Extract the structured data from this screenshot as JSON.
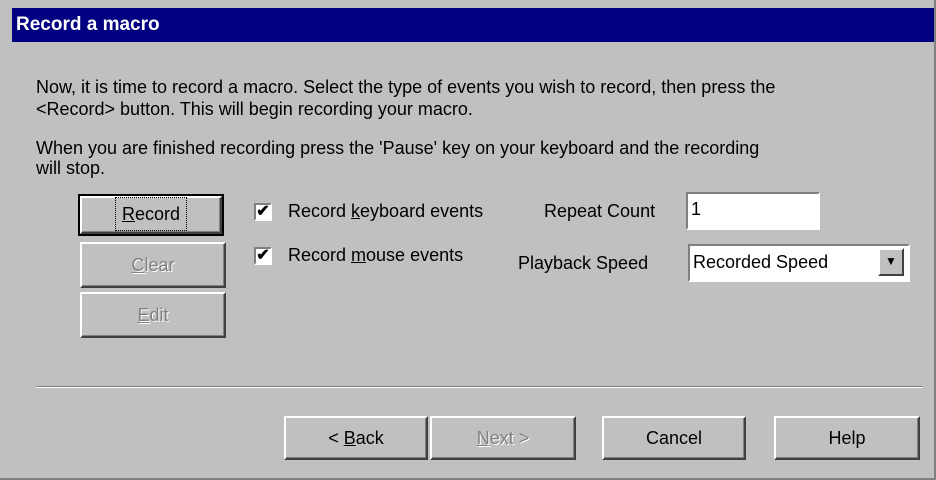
{
  "dialog": {
    "title": "Record a macro",
    "intro_line1": "Now, it is time to record a macro.  Select the type of events you wish to record, then press the",
    "intro_line2": "<Record> button.  This will begin recording your macro.",
    "finish_line1": "When you are finished recording press the 'Pause' key on your keyboard and the recording",
    "finish_line2": "will stop."
  },
  "buttons": {
    "record": {
      "pre": "",
      "u": "R",
      "post": "ecord"
    },
    "clear": {
      "pre": "",
      "u": "C",
      "post": "lear"
    },
    "edit": {
      "pre": "",
      "u": "E",
      "post": "dit"
    }
  },
  "options": {
    "keyboard": {
      "checked": true,
      "pre": "Record ",
      "u": "k",
      "post": "eyboard events"
    },
    "mouse": {
      "checked": true,
      "pre": "Record ",
      "u": "m",
      "post": "ouse events"
    },
    "check_glyph": "✔",
    "repeat_label": "Repeat Count",
    "repeat_value": "1",
    "speed_label": "Playback Speed",
    "speed_value": "Recorded Speed",
    "dropdown_icon": "▼"
  },
  "footer": {
    "back": {
      "pre": "< ",
      "u": "B",
      "post": "ack"
    },
    "next": {
      "pre": "",
      "u": "N",
      "post": "ext >"
    },
    "cancel": "Cancel",
    "help": "Help"
  }
}
